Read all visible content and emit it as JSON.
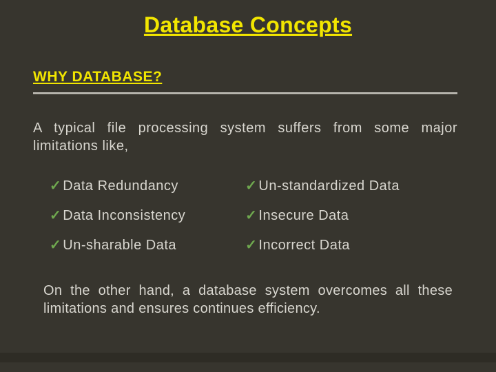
{
  "title": "Database Concepts",
  "subtitle": "WHY DATABASE?",
  "intro": "A typical file processing system suffers from some major limitations like,",
  "items": {
    "left": [
      "Data Redundancy",
      "Data Inconsistency",
      "Un-sharable Data"
    ],
    "right": [
      "Un-standardized Data",
      "Insecure Data",
      "Incorrect Data"
    ]
  },
  "conclusion": "On the other hand, a database system overcomes all these limitations and ensures continues efficiency.",
  "check_glyph": "✓"
}
